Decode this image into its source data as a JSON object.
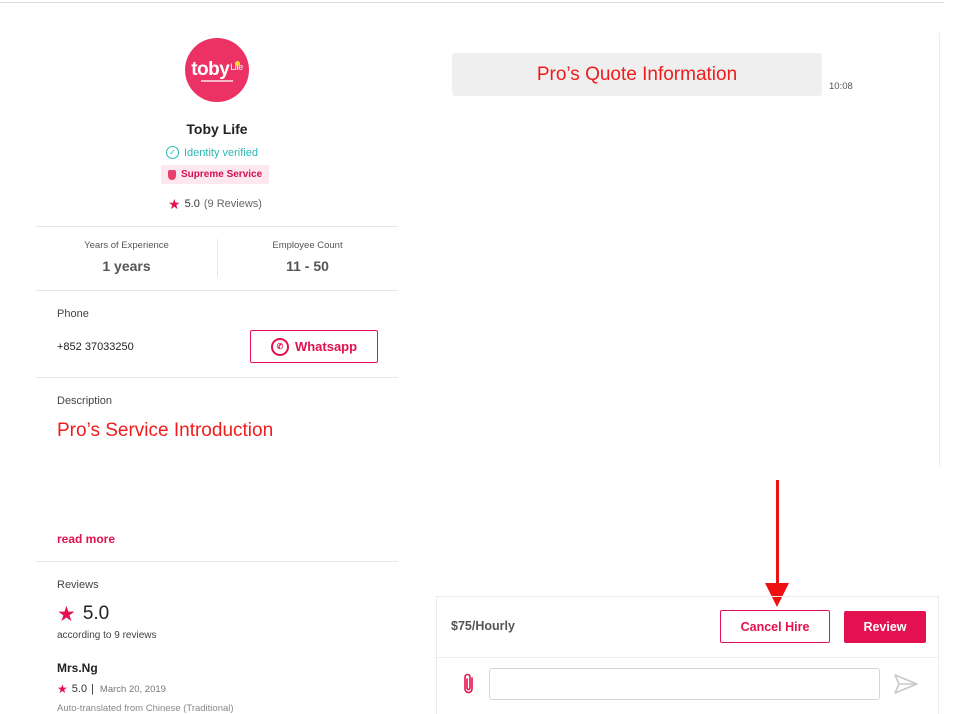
{
  "pro": {
    "logo_text": "toby",
    "logo_small": "Life",
    "name": "Toby Life",
    "verified_label": "Identity verified",
    "badge_label": "Supreme Service",
    "rating": "5.0",
    "reviews_count_label": "(9 Reviews)"
  },
  "stats": {
    "experience_label": "Years of Experience",
    "experience_value": "1 years",
    "employees_label": "Employee Count",
    "employees_value": "11 - 50"
  },
  "phone": {
    "label": "Phone",
    "number": "+852 37033250",
    "whatsapp_label": "Whatsapp"
  },
  "description": {
    "label": "Description",
    "text": "Pro’s Service Introduction",
    "read_more": "read more"
  },
  "reviews": {
    "label": "Reviews",
    "score": "5.0",
    "subtitle": "according to 9 reviews",
    "items": [
      {
        "reviewer": "Mrs.Ng",
        "rating": "5.0",
        "separator": "|",
        "date": "March 20, 2019",
        "translation_note": "Auto-translated from Chinese (Traditional)"
      }
    ]
  },
  "chat": {
    "messages": [
      {
        "text": "Pro’s Quote Information",
        "time": "10:08"
      }
    ],
    "price": "$75/Hourly",
    "cancel_label": "Cancel Hire",
    "review_label": "Review",
    "input_placeholder": ""
  },
  "colors": {
    "brand": "#e3114f",
    "annotation_red": "#ee1c1c",
    "verified_teal": "#2bb8b1"
  },
  "icons": [
    "star-icon",
    "check-circle-icon",
    "shield-icon",
    "whatsapp-icon",
    "paperclip-icon",
    "send-icon",
    "arrow-annotation"
  ]
}
